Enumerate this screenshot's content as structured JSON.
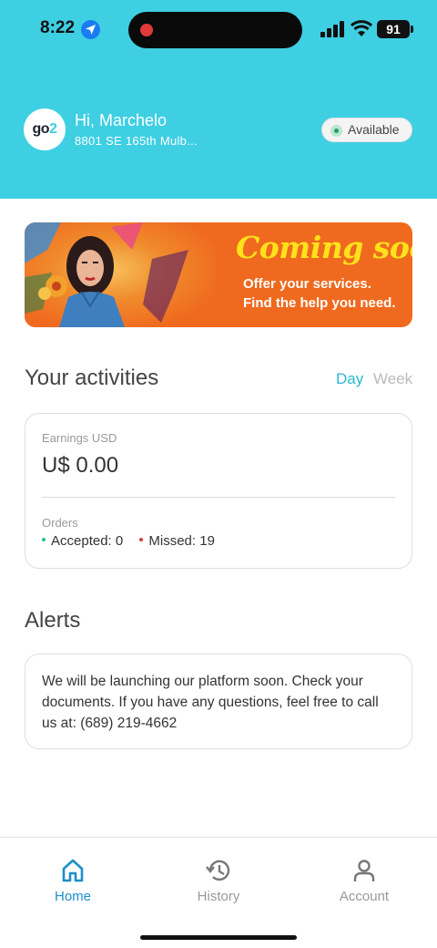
{
  "status_bar": {
    "time": "8:22",
    "battery": "91"
  },
  "header": {
    "avatar_prefix": "go",
    "avatar_suffix": "2",
    "greeting": "Hi, Marchelo",
    "address": "8801 SE 165th Mulb...",
    "availability": "Available"
  },
  "banner": {
    "title": "Coming soon",
    "line1": "Offer your services.",
    "line2": "Find the help you need."
  },
  "activities": {
    "title": "Your activities",
    "tabs": [
      "Day",
      "Week"
    ],
    "active_tab": "Day",
    "earnings_label": "Earnings USD",
    "earnings_value": "U$ 0.00",
    "orders_label": "Orders",
    "accepted": "Accepted: 0",
    "missed": "Missed: 19"
  },
  "alerts": {
    "title": "Alerts",
    "message": "We will be launching our platform soon. Check your documents. If you have any questions, feel free to call us at: (689) 219-4662"
  },
  "tabbar": {
    "items": [
      {
        "label": "Home",
        "icon": "home-icon"
      },
      {
        "label": "History",
        "icon": "history-icon"
      },
      {
        "label": "Account",
        "icon": "account-icon"
      }
    ],
    "active": "Home"
  },
  "colors": {
    "brand": "#3ecfe3",
    "accent": "#2bb8d4",
    "banner_bg": "#ef6a1f",
    "banner_title": "#ffe21a",
    "tab_active": "#1c8ecb"
  }
}
